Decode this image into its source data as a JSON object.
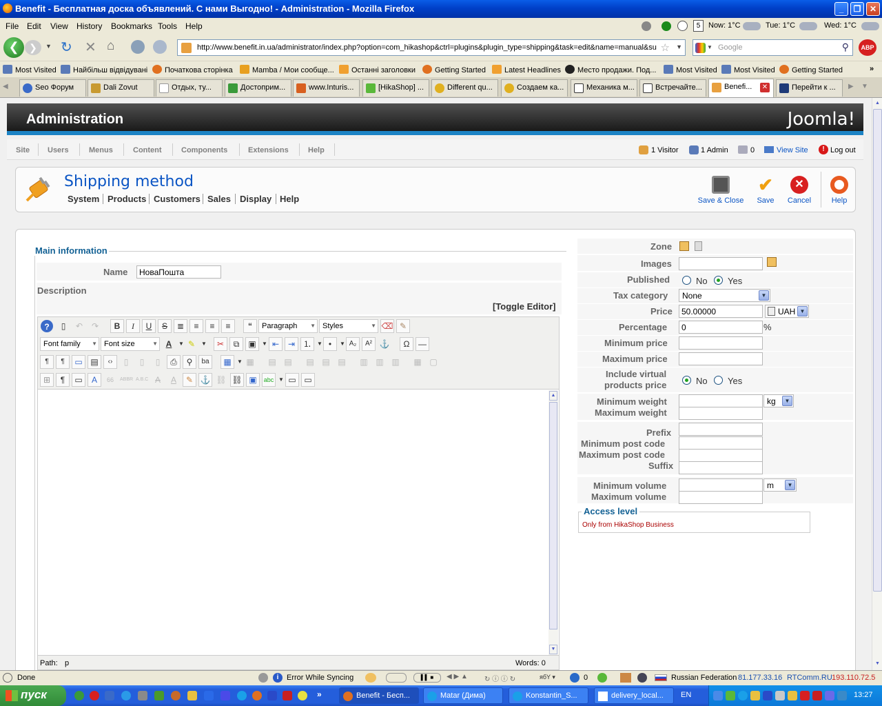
{
  "window": {
    "title": "Benefit - Бесплатная доска объявлений. С нами Выгодно! - Administration - Mozilla Firefox"
  },
  "menubar": {
    "items": [
      "File",
      "Edit",
      "View",
      "History",
      "Bookmarks",
      "Tools",
      "Help"
    ],
    "weather": {
      "now": "Now: 1°C",
      "tue": "Tue: 1°C",
      "wed": "Wed: 1°C"
    }
  },
  "navbar": {
    "url": "http://www.benefit.in.ua/administrator/index.php?option=com_hikashop&ctrl=plugins&plugin_type=shipping&task=edit&name=manual&su",
    "search_placeholder": "Google",
    "calendar_day": "5"
  },
  "bookmarks": [
    "Most Visited",
    "Найбільш відвідувані",
    "Початкова сторінка",
    "Mamba / Мои сообще...",
    "Останні заголовки",
    "Getting Started",
    "Latest Headlines",
    "Место продажи. Под...",
    "Most Visited",
    "Most Visited",
    "Getting Started"
  ],
  "tabs": [
    "Seo Форум",
    "Dali Zovut",
    "Отдых, ту...",
    "Достоприм...",
    "www.Inturis...",
    "[HikaShop] ...",
    "Different qu...",
    "Создаем ка...",
    "Механика м...",
    "Встречайте...",
    "Benefi...",
    "Перейти к ..."
  ],
  "admin": {
    "header_title": "Administration",
    "logo": "Joomla!",
    "menu": [
      "Site",
      "Users",
      "Menus",
      "Content",
      "Components",
      "Extensions",
      "Help"
    ],
    "status": {
      "visitors": "1 Visitor",
      "admins": "1 Admin",
      "messages": "0",
      "view_site": "View Site",
      "logout": "Log out"
    }
  },
  "toolbar": {
    "title": "Shipping method",
    "submenu": [
      "System",
      "Products",
      "Customers",
      "Sales",
      "Display",
      "Help"
    ],
    "buttons": {
      "save_close": "Save & Close",
      "save": "Save",
      "cancel": "Cancel",
      "help": "Help"
    }
  },
  "main_info": {
    "legend": "Main information",
    "name_label": "Name",
    "name_value": "НоваПошта",
    "description_label": "Description",
    "toggle_editor": "[Toggle Editor]",
    "editor": {
      "format_select": "Paragraph",
      "styles_select": "Styles",
      "font_family": "Font family",
      "font_size": "Font size",
      "path_label": "Path:",
      "path_value": "p",
      "words": "Words: 0"
    }
  },
  "form": {
    "zone_label": "Zone",
    "images_label": "Images",
    "published_label": "Published",
    "no": "No",
    "yes": "Yes",
    "published": "Yes",
    "tax_label": "Tax category",
    "tax_value": "None",
    "price_label": "Price",
    "price_value": "50.00000",
    "currency": "UAH",
    "percentage_label": "Percentage",
    "percentage_value": "0",
    "percent_sign": "%",
    "min_price_label": "Minimum price",
    "max_price_label": "Maximum price",
    "virtual_label_1": "Include virtual",
    "virtual_label_2": "products price",
    "include_virtual": "No",
    "min_weight_label": "Minimum weight",
    "max_weight_label": "Maximum weight",
    "weight_unit": "kg",
    "prefix_label": "Prefix",
    "min_post_label": "Minimum post code",
    "max_post_label": "Maximum post code",
    "suffix_label": "Suffix",
    "min_volume_label": "Minimum volume",
    "max_volume_label": "Maximum volume",
    "volume_unit": "m",
    "access_legend": "Access level",
    "access_note": "Only from HikaShop Business"
  },
  "statusbar": {
    "done": "Done",
    "sync": "Error While Syncing",
    "count": "0",
    "country": "Russian Federation",
    "ip": "81.177.33.16",
    "isp": "RTComm.RU",
    "ip2": "193.110.72.5"
  },
  "taskbar": {
    "start": "пуск",
    "items": [
      "Benefit - Бесп...",
      "Matar (Дима)",
      "Konstantin_S...",
      "delivery_local..."
    ],
    "lang": "EN",
    "time": "13:27"
  },
  "colors": {
    "accent": "#0b55c4",
    "joomla_bar": "#1c83c5",
    "title_blue": "#146295",
    "access_red": "#aa0000"
  }
}
